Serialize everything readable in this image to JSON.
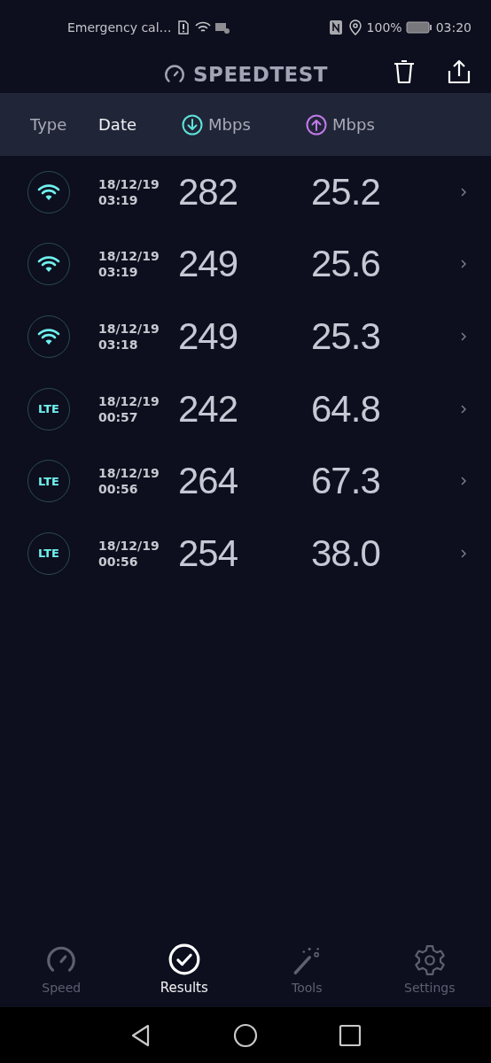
{
  "status_bar": {
    "carrier": "Emergency cal…",
    "battery": "100%",
    "time": "03:20"
  },
  "app_bar": {
    "title": "SPEEDTEST"
  },
  "columns": [
    {
      "label": "Type",
      "kind": "text",
      "selected": false
    },
    {
      "label": "Date",
      "kind": "text",
      "selected": true
    },
    {
      "label": "Mbps",
      "kind": "download",
      "selected": false
    },
    {
      "label": "Mbps",
      "kind": "upload",
      "selected": false
    }
  ],
  "rows": [
    {
      "kind": "wifi",
      "date": "18/12/19",
      "time": "03:19",
      "download": "282",
      "upload": "25.2"
    },
    {
      "kind": "wifi",
      "date": "18/12/19",
      "time": "03:19",
      "download": "249",
      "upload": "25.6"
    },
    {
      "kind": "wifi",
      "date": "18/12/19",
      "time": "03:18",
      "download": "249",
      "upload": "25.3"
    },
    {
      "kind": "lte",
      "type_label": "LTE",
      "date": "18/12/19",
      "time": "00:57",
      "download": "242",
      "upload": "64.8"
    },
    {
      "kind": "lte",
      "type_label": "LTE",
      "date": "18/12/19",
      "time": "00:56",
      "download": "264",
      "upload": "67.3"
    },
    {
      "kind": "lte",
      "type_label": "LTE",
      "date": "18/12/19",
      "time": "00:56",
      "download": "254",
      "upload": "38.0"
    }
  ],
  "tabs": [
    {
      "label": "Speed",
      "kind": "speed",
      "selected": false
    },
    {
      "label": "Results",
      "kind": "results",
      "selected": true
    },
    {
      "label": "Tools",
      "kind": "tools",
      "selected": false
    },
    {
      "label": "Settings",
      "kind": "settings",
      "selected": false
    }
  ]
}
